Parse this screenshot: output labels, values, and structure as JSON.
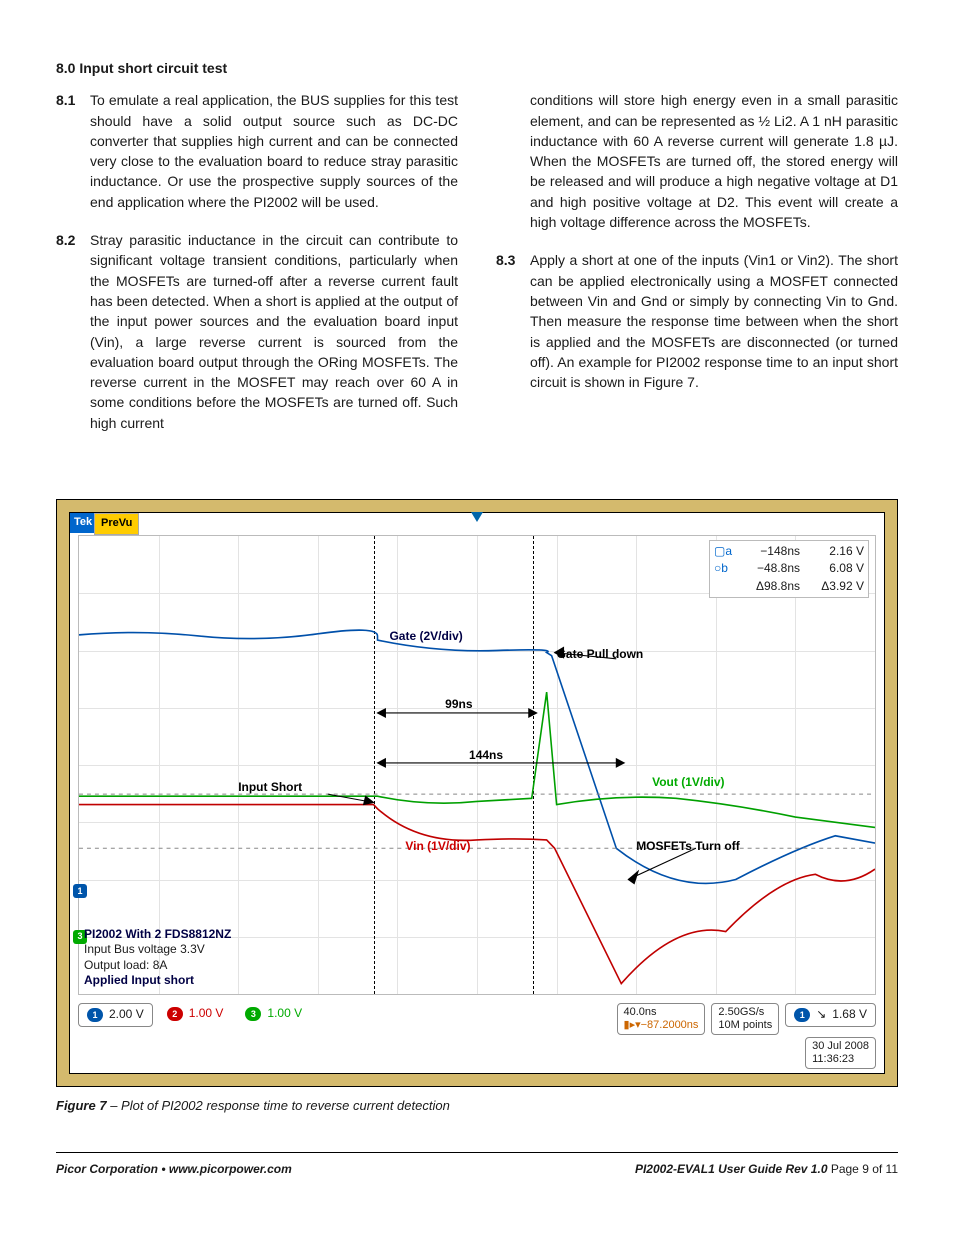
{
  "heading": "8.0 Input short circuit test",
  "items_left": [
    {
      "num": "8.1",
      "text": "To emulate a real application, the BUS supplies for this test should have a solid output source such as DC-DC converter that supplies high current and can be connected very close to the evaluation board to reduce stray parasitic inductance. Or use the prospective supply sources of the end application where the PI2002 will be used."
    },
    {
      "num": "8.2",
      "text": "Stray parasitic inductance in the circuit can contribute to significant voltage transient conditions, particularly when the MOSFETs are turned-off after a reverse current fault has been detected. When a short is applied at the output of the input power sources and the evaluation board input (Vin), a large reverse current is sourced from the evaluation board output through the ORing MOSFETs. The reverse current in the MOSFET may reach over 60 A in some conditions before the MOSFETs are turned off. Such high current"
    }
  ],
  "items_right": [
    {
      "num": "",
      "text": "conditions will store high energy even in a small parasitic element, and can be represented as ½ Li2.  A 1 nH parasitic inductance with 60 A reverse current will generate 1.8 µJ. When the MOSFETs are turned off, the stored energy will be released and will produce a high negative voltage at D1 and high positive voltage at D2. This event will create a high voltage difference across the MOSFETs."
    },
    {
      "num": "8.3",
      "text": "Apply a short at one of the inputs (Vin1 or Vin2). The short can be applied electronically using a MOSFET connected between Vin and Gnd or simply by connecting Vin to Gnd. Then measure the response time between when the short is applied and the MOSFETs are disconnected (or turned off). An example for PI2002 response time to an input short circuit is shown in Figure 7."
    }
  ],
  "scope": {
    "tek": "Tek",
    "prevu": "PreVu",
    "labels": {
      "gate": "Gate (2V/div)",
      "gate_pull": "Gate Pull down",
      "t99": "99ns",
      "t144": "144ns",
      "input_short": "Input Short",
      "vout": "Vout (1V/div)",
      "vin": "Vin (1V/div)",
      "mos_off": "MOSFETs Turn off"
    },
    "cursor_table": [
      {
        "mark": "a",
        "t": "−148ns",
        "v": "2.16 V"
      },
      {
        "mark": "b",
        "t": "−48.8ns",
        "v": "6.08 V"
      },
      {
        "mark": "Δ",
        "t": "Δ98.8ns",
        "v": "Δ3.92 V"
      }
    ],
    "notes": {
      "l1": "PI2002 With 2 FDS8812NZ",
      "l2": "Input Bus voltage 3.3V",
      "l3": "Output load: 8A",
      "l4": "Applied Input short"
    },
    "channels": [
      {
        "n": "1",
        "color": "#05a",
        "val": "2.00 V"
      },
      {
        "n": "2",
        "color": "#c00",
        "val": "1.00 V"
      },
      {
        "n": "3",
        "color": "#0a0",
        "val": "1.00 V"
      }
    ],
    "timebase": {
      "t": "40.0ns",
      "pos": "▮▸▾−87.2000ns"
    },
    "acq": {
      "rate": "2.50GS/s",
      "pts": "10M points"
    },
    "trig": {
      "ch": "1",
      "val": "1.68 V"
    },
    "date": {
      "d": "30 Jul  2008",
      "t": "11:36:23"
    }
  },
  "caption_b": "Figure 7",
  "caption_r": " – Plot of PI2002 response time to reverse current detection",
  "footer": {
    "left": "Picor Corporation • www.picorpower.com",
    "right_b": "PI2002-EVAL1 User Guide  Rev 1.0",
    "right_r": "  Page 9 of 11"
  },
  "chart_data": {
    "type": "line",
    "instrument": "Tektronix oscilloscope screenshot",
    "timebase_ns_per_div": 40,
    "sample_rate": "2.50GS/s",
    "record_length": "10M points",
    "trigger": {
      "channel": 1,
      "level_V": 1.68,
      "mode": "edge falling"
    },
    "cursors": {
      "a_ns": -148,
      "a_V": 2.16,
      "b_ns": -48.8,
      "b_V": 6.08,
      "delta_ns": 98.8,
      "delta_V": 3.92
    },
    "annotations": {
      "gate_pulldown_at_ns": 0,
      "delay_input_short_to_gate_ns": 99,
      "delay_input_short_to_mosfet_off_ns": 144
    },
    "series": [
      {
        "name": "CH1 Gate",
        "scale_V_per_div": 2.0,
        "color": "#0050aa",
        "behavior": "≈5–6 V noisy plateau until t≈0 ns then rapid fall toward ≈0 V at MOSFET turn-off"
      },
      {
        "name": "CH2 Vin",
        "scale_V_per_div": 1.0,
        "color": "#c00000",
        "behavior": "≈3.3 V until input short at t≈−148 ns, collapses toward 0 V, large negative swing after MOSFET turn-off then recovers"
      },
      {
        "name": "CH3 Vout",
        "scale_V_per_div": 1.0,
        "color": "#00a000",
        "behavior": "≈3.3 V, dips after short, spikes high at gate pulldown, then droops slowly after MOSFETs turn off"
      }
    ],
    "conditions": {
      "device": "PI2002 with 2× FDS8812NZ",
      "vin_bus_V": 3.3,
      "load_A": 8,
      "event": "Applied input short"
    }
  }
}
